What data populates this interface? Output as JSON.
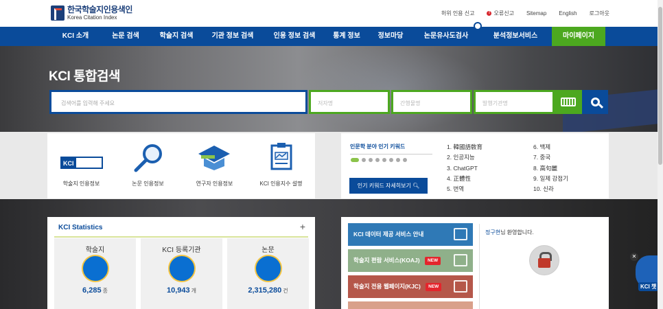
{
  "header": {
    "logo_ko": "한국학술지인용색인",
    "logo_en": "Korea Citation Index",
    "util_links": [
      "허위 인용 신고",
      "오류신고",
      "Sitemap",
      "English",
      "로그아웃"
    ]
  },
  "nav": {
    "items": [
      "KCI 소개",
      "논문 검색",
      "학술지 검색",
      "기관 정보 검색",
      "인용 정보 검색",
      "통계 정보",
      "정보마당",
      "논문유사도검사",
      "분석정보서비스",
      "마이페이지"
    ],
    "active_color": "#4ca81f",
    "bar_color": "#0a4b9a"
  },
  "search": {
    "title": "KCI 통합검색",
    "main_placeholder": "검색어를 입력해 주세요",
    "author_placeholder": "저자명",
    "year_placeholder": "간행물명",
    "publisher_placeholder": "발행기관명"
  },
  "services": [
    "학술지 인용정보",
    "논문 인용정보",
    "연구자 인용정보",
    "KCI 인용지수 설명"
  ],
  "keywords": {
    "title": "인문학 분야 인기 키워드",
    "button": "인기 키워드 자세히보기",
    "col1": [
      "1. 韓國語敎育",
      "2. 인공지능",
      "3. ChatGPT",
      "4. 正體性",
      "5. 번역"
    ],
    "col2": [
      "6. 백제",
      "7. 중국",
      "8. 高句麗",
      "9. 일제 강점기",
      "10. 신라"
    ]
  },
  "statistics": {
    "title": "KCI Statistics",
    "items": [
      {
        "label": "학술지",
        "value": "6,285",
        "unit": "종"
      },
      {
        "label": "KCI 등록기관",
        "value": "10,943",
        "unit": "개"
      },
      {
        "label": "논문",
        "value": "2,315,280",
        "unit": "건"
      }
    ]
  },
  "service_list": [
    {
      "label": "KCI 데이터 제공 서비스 안내",
      "new": "",
      "color": "#2f79b6"
    },
    {
      "label": "학술지 편람 서비스(KOAJ)",
      "new": "NEW",
      "color": "#8fb08a"
    },
    {
      "label": "학술지 전용 웹페이지(KJC)",
      "new": "NEW",
      "color": "#b5574a"
    }
  ],
  "welcome": {
    "name": "정구현",
    "suffix": "님 환영합니다."
  },
  "chatbot": {
    "label": "KCI 챗"
  }
}
